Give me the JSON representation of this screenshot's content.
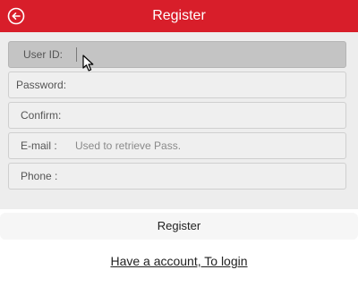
{
  "header": {
    "title": "Register",
    "back_icon": "circle-arrow-left-icon"
  },
  "form": {
    "user_id": {
      "label": "User ID:",
      "value": "",
      "placeholder": ""
    },
    "password": {
      "label": "Password:",
      "value": "",
      "placeholder": ""
    },
    "confirm": {
      "label": "Confirm:",
      "value": "",
      "placeholder": ""
    },
    "email": {
      "label": "E-mail :",
      "value": "",
      "placeholder": "Used to retrieve Pass."
    },
    "phone": {
      "label": "Phone :",
      "value": "",
      "placeholder": ""
    }
  },
  "actions": {
    "register_label": "Register",
    "login_link": "Have a account, To login"
  },
  "colors": {
    "header_bg": "#d81e2a",
    "form_bg": "#ededed",
    "active_field_bg": "#c4c4c4"
  }
}
